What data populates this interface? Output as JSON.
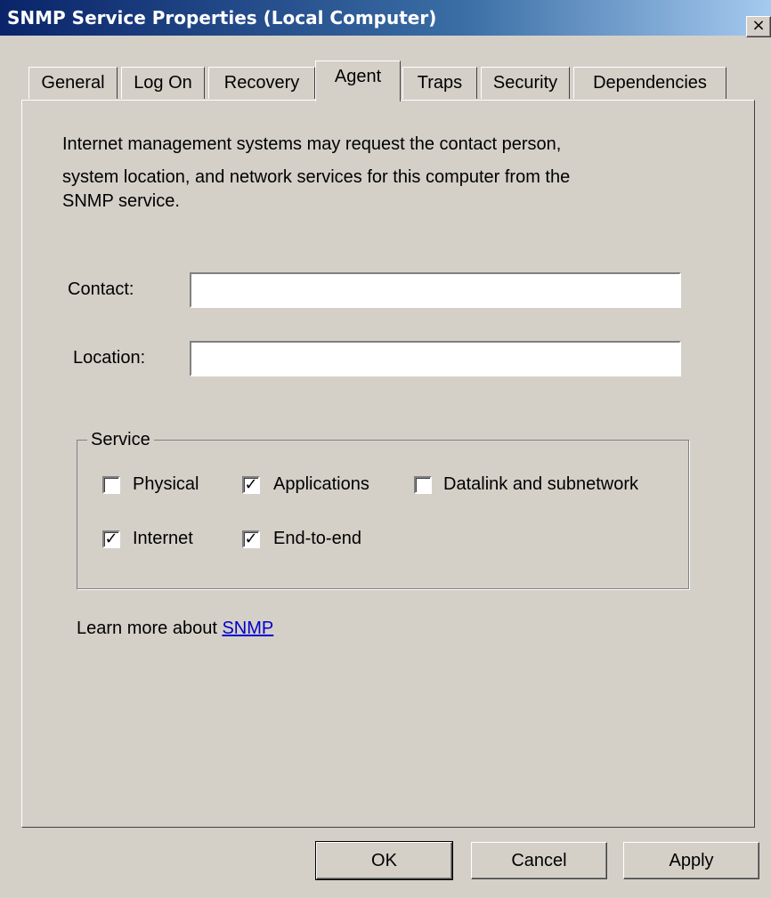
{
  "window": {
    "title": "SNMP Service Properties (Local Computer)",
    "close_glyph": "×"
  },
  "tabs": [
    {
      "label": "General"
    },
    {
      "label": "Log On"
    },
    {
      "label": "Recovery"
    },
    {
      "label": "Agent",
      "active": true
    },
    {
      "label": "Traps"
    },
    {
      "label": "Security"
    },
    {
      "label": "Dependencies"
    }
  ],
  "agent": {
    "description_lines": [
      "Internet management systems may request the contact person,",
      "system location, and network services for this computer from the",
      "SNMP service."
    ],
    "contact": {
      "label": "Contact:",
      "value": ""
    },
    "location": {
      "label": "Location:",
      "value": ""
    },
    "service": {
      "label": "Service",
      "check_glyph": "✓",
      "options": [
        {
          "label": "Physical",
          "checked": false
        },
        {
          "label": "Applications",
          "checked": true
        },
        {
          "label": "Datalink and subnetwork",
          "checked": false
        },
        {
          "label": "Internet",
          "checked": true
        },
        {
          "label": "End-to-end",
          "checked": true
        }
      ]
    },
    "learn_more": {
      "text": "Learn more about",
      "link": "SNMP"
    }
  },
  "buttons": {
    "ok": "OK",
    "cancel": "Cancel",
    "apply": "Apply"
  },
  "colors": {
    "face": "#d4d0c8",
    "title_start": "#0a246a",
    "title_end": "#a6caf0",
    "link": "#0000cc"
  }
}
